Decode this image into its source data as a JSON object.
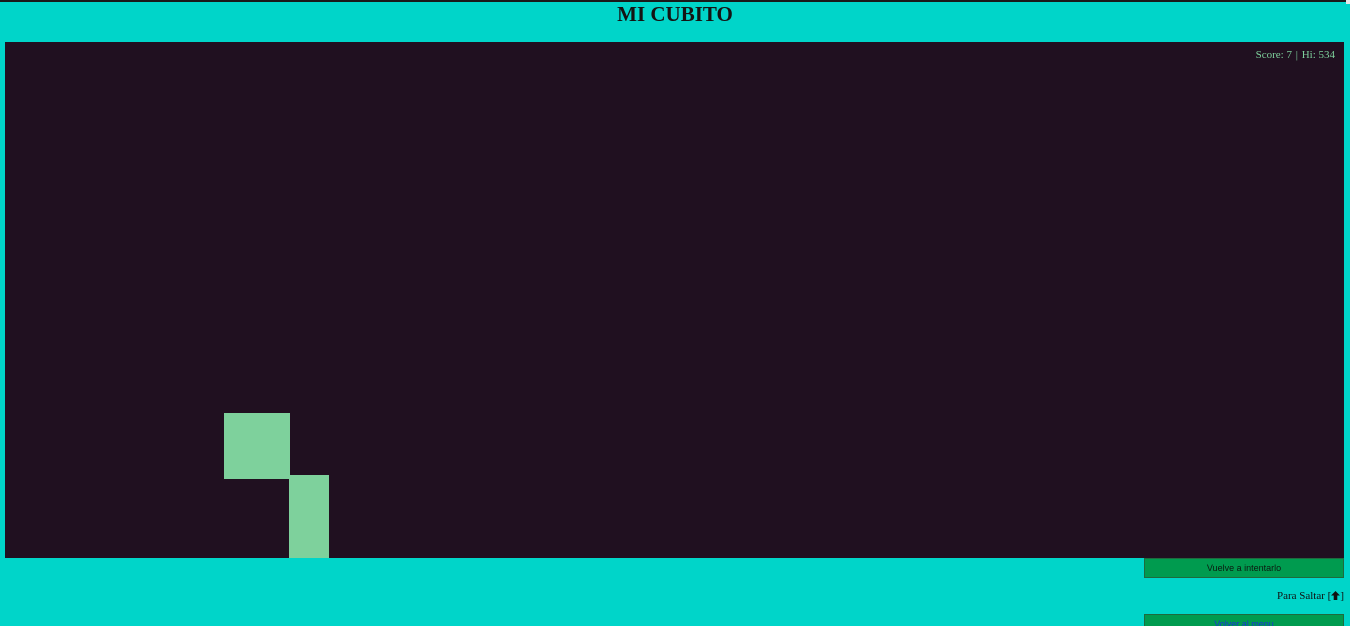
{
  "header": {
    "title": "MI CUBITO"
  },
  "game": {
    "score_label": "Score:",
    "score": "7",
    "separator": "|",
    "hi_label": "Hi:",
    "hi_score": "534",
    "colors": {
      "page_bg": "#00d5c9",
      "canvas_bg": "#201020",
      "sprite": "#7ed19c",
      "button": "#009b4f"
    }
  },
  "controls": {
    "retry_label": "Vuelve a intentarlo",
    "jump_hint_prefix": "Para Saltar [",
    "jump_hint_suffix": "]",
    "jump_key_icon": "arrow-up-icon",
    "menu_label": "Volver al menu"
  }
}
